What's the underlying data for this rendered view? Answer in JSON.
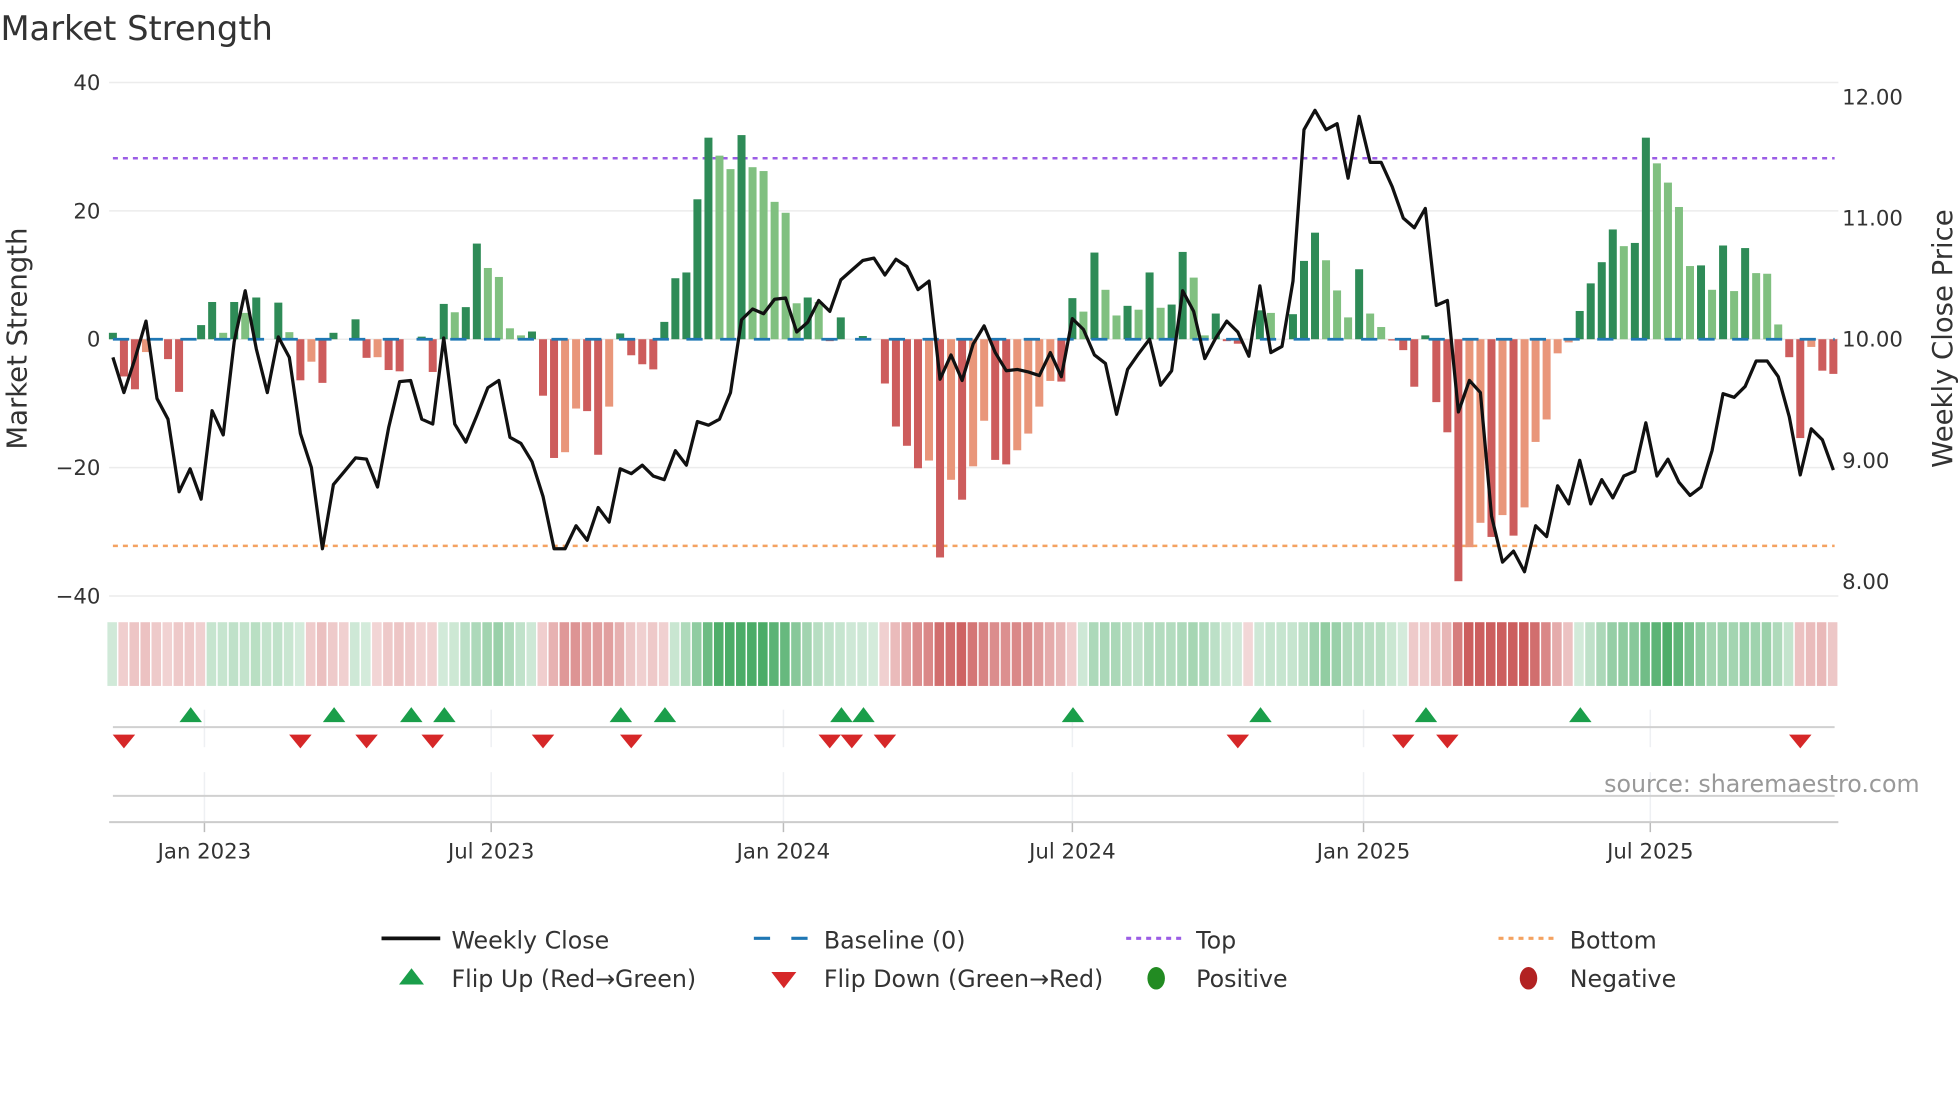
{
  "title": "Market Strength",
  "source": "source: sharemaestro.com",
  "colors": {
    "pos_rising": "#2e8b57",
    "pos_falling": "#80c080",
    "neg_falling": "#cd5c5c",
    "neg_rising": "#e9967a",
    "line": "#111111",
    "baseline": "#1f77b4",
    "top": "#9b5de5",
    "bottom": "#f4a261",
    "flip_up": "#1a9e4a",
    "flip_down": "#d62728",
    "positive": "#228b22",
    "negative": "#b22222"
  },
  "chart_data": {
    "type": "bar",
    "title": "Market Strength",
    "ylabel": "Market Strength",
    "y2label": "Weekly Close Price",
    "ylim": [
      -40,
      40
    ],
    "y2lim": [
      7.88,
      12.12
    ],
    "y_ticks": [
      "40",
      "20",
      "0",
      "−20",
      "−40"
    ],
    "y_tick_values": [
      40,
      20,
      0,
      -20,
      -40
    ],
    "y2_ticks": [
      "12.00",
      "11.00",
      "10.00",
      "9.00",
      "8.00"
    ],
    "y2_tick_values": [
      12,
      11,
      10,
      9,
      8
    ],
    "x_ticks": [
      "Jan 2023",
      "Jul 2023",
      "Jan 2024",
      "Jul 2024",
      "Jan 2025",
      "Jul 2025"
    ],
    "top_level": 28.2,
    "bottom_level": -32.2,
    "baseline": 0,
    "strength": [
      1.0,
      -5.8,
      -7.8,
      -2,
      0,
      -3.1,
      -8.2,
      0,
      2.2,
      5.8,
      1.0,
      5.8,
      4.1,
      6.5,
      0,
      5.7,
      1.1,
      -6.4,
      -3.5,
      -6.8,
      1.0,
      0,
      3.1,
      -2.9,
      -2.8,
      -4.8,
      -5.0,
      0,
      0.4,
      -5.1,
      5.5,
      4.2,
      5.0,
      14.9,
      11.1,
      9.7,
      1.7,
      0.6,
      1.2,
      -8.8,
      -18.5,
      -17.6,
      -10.8,
      -11.2,
      -18.0,
      -10.5,
      0.9,
      -2.5,
      -3.9,
      -4.7,
      2.7,
      9.5,
      10.4,
      21.8,
      31.4,
      28.6,
      26.5,
      31.8,
      26.8,
      26.2,
      21.4,
      19.7,
      5.6,
      6.5,
      5.8,
      -0.3,
      3.4,
      0,
      0.5,
      0,
      -6.9,
      -13.6,
      -16.6,
      -20.1,
      -18.9,
      -34,
      -21.9,
      -25,
      -19.8,
      -12.7,
      -18.8,
      -19.5,
      -17.3,
      -14.7,
      -10.5,
      -6.5,
      -6.6,
      6.4,
      4.3,
      13.5,
      7.7,
      3.7,
      5.2,
      4.6,
      10.4,
      4.9,
      5.4,
      13.6,
      9.6,
      0.6,
      4.0,
      -0.3,
      -0.7,
      0,
      4.5,
      4.1,
      0,
      3.9,
      12.2,
      16.6,
      12.3,
      7.6,
      3.4,
      10.9,
      4.0,
      1.9,
      -0.2,
      -1.7,
      -7.4,
      0.6,
      -9.8,
      -14.5,
      -37.7,
      -32.4,
      -28.6,
      -30.8,
      -27.4,
      -30.6,
      -26.2,
      -16,
      -12.5,
      -2.2,
      -0.5,
      4.4,
      8.7,
      12,
      17.1,
      14.5,
      15,
      31.4,
      27.4,
      24.4,
      20.6,
      11.4,
      11.5,
      7.7,
      14.6,
      7.5,
      14.2,
      10.3,
      10.2,
      2.3,
      -2.8,
      -15.4,
      -1.2,
      -4.9,
      -5.4
    ],
    "weekly_close": [
      9.85,
      9.56,
      9.84,
      10.15,
      9.51,
      9.34,
      8.74,
      8.93,
      8.68,
      9.41,
      9.21,
      9.98,
      10.4,
      9.92,
      9.56,
      10.02,
      9.85,
      9.22,
      8.94,
      8.27,
      8.8,
      8.91,
      9.02,
      9.01,
      8.78,
      9.27,
      9.65,
      9.66,
      9.34,
      9.3,
      10.01,
      9.3,
      9.15,
      9.37,
      9.6,
      9.66,
      9.19,
      9.14,
      8.99,
      8.7,
      8.27,
      8.27,
      8.46,
      8.34,
      8.61,
      8.49,
      8.93,
      8.89,
      8.96,
      8.87,
      8.84,
      9.08,
      8.96,
      9.32,
      9.29,
      9.34,
      9.56,
      10.16,
      10.25,
      10.21,
      10.33,
      10.34,
      10.06,
      10.14,
      10.32,
      10.23,
      10.49,
      10.57,
      10.65,
      10.67,
      10.53,
      10.66,
      10.6,
      10.41,
      10.48,
      9.67,
      9.87,
      9.66,
      9.96,
      10.11,
      9.89,
      9.74,
      9.75,
      9.73,
      9.7,
      9.89,
      9.69,
      10.17,
      10.08,
      9.87,
      9.8,
      9.38,
      9.75,
      9.88,
      10.0,
      9.62,
      9.74,
      10.4,
      10.23,
      9.84,
      10.01,
      10.15,
      10.06,
      9.86,
      10.44,
      9.89,
      9.94,
      10.48,
      11.73,
      11.89,
      11.73,
      11.78,
      11.33,
      11.84,
      11.46,
      11.46,
      11.26,
      11.0,
      10.92,
      11.08,
      10.28,
      10.32,
      9.4,
      9.66,
      9.56,
      8.54,
      8.16,
      8.25,
      8.08,
      8.46,
      8.37,
      8.79,
      8.64,
      9.0,
      8.64,
      8.84,
      8.69,
      8.87,
      8.91,
      9.31,
      8.87,
      9.01,
      8.82,
      8.71,
      8.78,
      9.08,
      9.55,
      9.52,
      9.61,
      9.82,
      9.82,
      9.69,
      9.36,
      8.88,
      9.26,
      9.17,
      8.92
    ],
    "flip_up_weeks": [
      7,
      20,
      27,
      30,
      46,
      50,
      66,
      68,
      87,
      104,
      119,
      133
    ],
    "flip_down_weeks": [
      1,
      17,
      23,
      29,
      39,
      47,
      65,
      67,
      70,
      102,
      117,
      121,
      153
    ],
    "legend": {
      "placement": "bottom",
      "items": [
        "Weekly Close",
        "Baseline (0)",
        "Top",
        "Bottom",
        "Flip Up (Red→Green)",
        "Flip Down (Green→Red)",
        "Positive",
        "Negative"
      ]
    }
  }
}
